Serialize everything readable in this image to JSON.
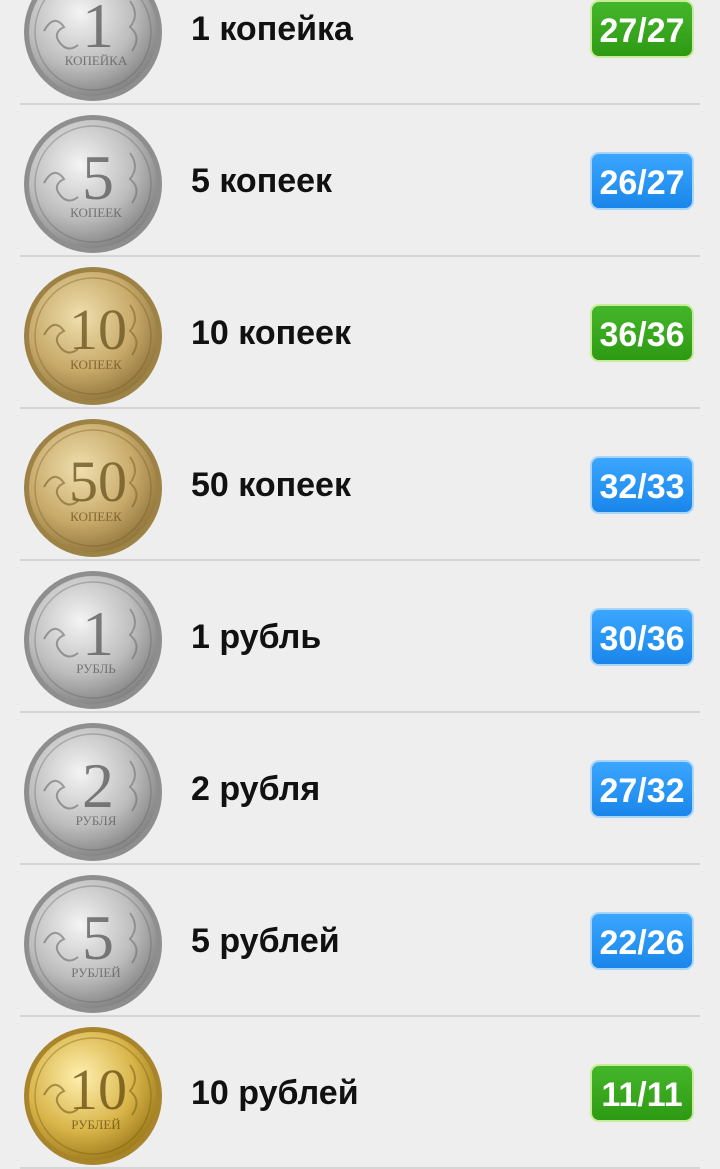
{
  "colors": {
    "complete_badge": "#33a51b",
    "partial_badge": "#2196f3",
    "background": "#eeeeee"
  },
  "coins": [
    {
      "label": "1 копейка",
      "count": "27/27",
      "status": "complete",
      "metal": "silver",
      "denomination": "1",
      "inscription": "КОПЕЙКА",
      "icon": "coin-1-kopeck-icon"
    },
    {
      "label": "5 копеек",
      "count": "26/27",
      "status": "partial",
      "metal": "silver",
      "denomination": "5",
      "inscription": "КОПЕЕК",
      "icon": "coin-5-kopecks-icon"
    },
    {
      "label": "10 копеек",
      "count": "36/36",
      "status": "complete",
      "metal": "brass",
      "denomination": "10",
      "inscription": "КОПЕЕК",
      "icon": "coin-10-kopecks-icon"
    },
    {
      "label": "50 копеек",
      "count": "32/33",
      "status": "partial",
      "metal": "brass",
      "denomination": "50",
      "inscription": "КОПЕЕК",
      "icon": "coin-50-kopecks-icon"
    },
    {
      "label": "1 рубль",
      "count": "30/36",
      "status": "partial",
      "metal": "silver",
      "denomination": "1",
      "inscription": "РУБЛЬ",
      "icon": "coin-1-ruble-icon"
    },
    {
      "label": "2 рубля",
      "count": "27/32",
      "status": "partial",
      "metal": "silver",
      "denomination": "2",
      "inscription": "РУБЛЯ",
      "icon": "coin-2-rubles-icon"
    },
    {
      "label": "5 рублей",
      "count": "22/26",
      "status": "partial",
      "metal": "silver",
      "denomination": "5",
      "inscription": "РУБЛЕЙ",
      "icon": "coin-5-rubles-icon"
    },
    {
      "label": "10 рублей",
      "count": "11/11",
      "status": "complete",
      "metal": "gold",
      "denomination": "10",
      "inscription": "РУБЛЕЙ",
      "icon": "coin-10-rubles-icon"
    }
  ]
}
